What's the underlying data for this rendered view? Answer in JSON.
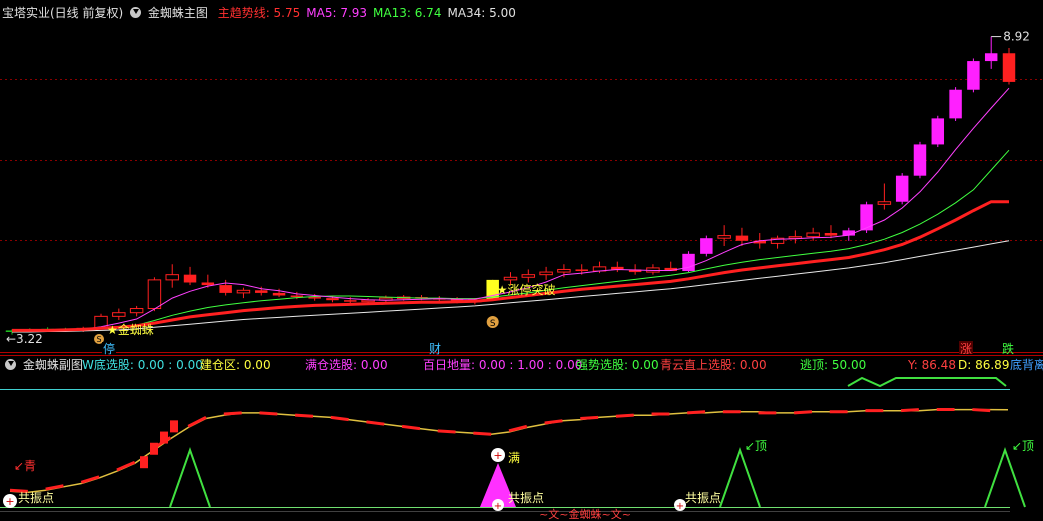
{
  "main_header": {
    "stock": "宝塔实业(日线 前复权)",
    "indicator": "金蜘蛛主图",
    "items": [
      {
        "label": "主趋势线:",
        "value": "5.75",
        "color": "#ff3030"
      },
      {
        "label": "MA5:",
        "value": "7.93",
        "color": "#ff40ff"
      },
      {
        "label": "MA13:",
        "value": "6.74",
        "color": "#40ff40"
      },
      {
        "label": "MA34:",
        "value": "5.00",
        "color": "#e0e0e0"
      }
    ]
  },
  "sub_header": {
    "indicator": "金蜘蛛副图",
    "items": [
      {
        "text": "W底选股: 0.00 : 0.00",
        "color": "#40e0e0"
      },
      {
        "text": "建仓区: 0.00",
        "color": "#ffff40"
      },
      {
        "text": "满仓选股: 0.00",
        "color": "#ff40ff"
      },
      {
        "text": "百日地量: 0.00 : 1.00 : 0.00",
        "color": "#ff40ff"
      },
      {
        "text": "强势选股: 0.00",
        "color": "#40ff40"
      },
      {
        "text": "青云直上选股: 0.00",
        "color": "#ff4040"
      },
      {
        "text": "逃顶: 50.00",
        "color": "#40ff40"
      },
      {
        "text": "Y: 86.48",
        "color": "#ff4040"
      },
      {
        "text": "D: 86.89",
        "color": "#ffff40"
      },
      {
        "text": "底背离",
        "color": "#40a0ff"
      }
    ]
  },
  "price_labels": {
    "high": "8.92",
    "low": "3.22"
  },
  "markers": {
    "limit_up": "停",
    "finance": "财",
    "rise": "涨",
    "fall": "跌",
    "spider": "金蜘蛛",
    "breakout": "涨停突破",
    "s_icon": "S"
  },
  "sub_labels": {
    "qing": "青",
    "bottom_left": "共振点",
    "full": "满",
    "mid": "共振点",
    "right": "共振点",
    "top1": "顶",
    "top2": "顶",
    "spider_bottom": "~文~金蜘蛛~文~"
  },
  "colors": {
    "bg": "#000000",
    "up": "#ff2020",
    "down": "#ff2020",
    "magenta_candle": "#ff20ff",
    "grid": "#800000",
    "trend": "#ff2020",
    "ma5": "#ff40ff",
    "ma13": "#40ff40",
    "ma34": "#e8e8e8"
  },
  "chart_data": [
    {
      "type": "candlestick",
      "title": "金蜘蛛主图",
      "ylim": [
        3.0,
        9.2
      ],
      "candles": [
        [
          3.25,
          3.3,
          3.2,
          3.28
        ],
        [
          3.28,
          3.32,
          3.24,
          3.3
        ],
        [
          3.3,
          3.34,
          3.26,
          3.31
        ],
        [
          3.31,
          3.33,
          3.27,
          3.29
        ],
        [
          3.29,
          3.35,
          3.25,
          3.32
        ],
        [
          3.32,
          3.6,
          3.3,
          3.55
        ],
        [
          3.55,
          3.7,
          3.48,
          3.62
        ],
        [
          3.62,
          3.75,
          3.55,
          3.7
        ],
        [
          3.7,
          4.3,
          3.65,
          4.25
        ],
        [
          4.25,
          4.55,
          4.1,
          4.35
        ],
        [
          4.35,
          4.5,
          4.15,
          4.2
        ],
        [
          4.2,
          4.35,
          4.1,
          4.15
        ],
        [
          4.15,
          4.25,
          3.95,
          4.0
        ],
        [
          4.0,
          4.1,
          3.9,
          4.05
        ],
        [
          4.05,
          4.12,
          3.95,
          4.0
        ],
        [
          4.0,
          4.08,
          3.92,
          3.95
        ],
        [
          3.95,
          4.02,
          3.88,
          3.92
        ],
        [
          3.92,
          3.98,
          3.85,
          3.9
        ],
        [
          3.9,
          3.95,
          3.82,
          3.86
        ],
        [
          3.86,
          3.92,
          3.8,
          3.84
        ],
        [
          3.84,
          3.9,
          3.8,
          3.86
        ],
        [
          3.86,
          3.95,
          3.82,
          3.9
        ],
        [
          3.9,
          3.96,
          3.85,
          3.92
        ],
        [
          3.92,
          3.96,
          3.86,
          3.9
        ],
        [
          3.9,
          3.94,
          3.84,
          3.88
        ],
        [
          3.88,
          3.92,
          3.8,
          3.83
        ],
        [
          3.83,
          3.9,
          3.78,
          3.86
        ],
        [
          3.86,
          4.25,
          3.86,
          4.25
        ],
        [
          4.25,
          4.4,
          4.15,
          4.3
        ],
        [
          4.3,
          4.45,
          4.2,
          4.35
        ],
        [
          4.35,
          4.5,
          4.25,
          4.4
        ],
        [
          4.4,
          4.55,
          4.3,
          4.45
        ],
        [
          4.45,
          4.55,
          4.35,
          4.42
        ],
        [
          4.42,
          4.6,
          4.38,
          4.5
        ],
        [
          4.5,
          4.6,
          4.4,
          4.45
        ],
        [
          4.45,
          4.55,
          4.35,
          4.4
        ],
        [
          4.4,
          4.55,
          4.35,
          4.48
        ],
        [
          4.48,
          4.6,
          4.42,
          4.42
        ],
        [
          4.42,
          4.8,
          4.4,
          4.75
        ],
        [
          4.75,
          5.1,
          4.7,
          5.05
        ],
        [
          5.05,
          5.3,
          4.9,
          5.1
        ],
        [
          5.1,
          5.25,
          4.9,
          5.0
        ],
        [
          5.0,
          5.15,
          4.85,
          4.95
        ],
        [
          4.95,
          5.1,
          4.85,
          5.05
        ],
        [
          5.05,
          5.2,
          4.95,
          5.08
        ],
        [
          5.08,
          5.25,
          5.0,
          5.15
        ],
        [
          5.15,
          5.3,
          5.05,
          5.1
        ],
        [
          5.1,
          5.25,
          5.0,
          5.2
        ],
        [
          5.2,
          5.75,
          5.15,
          5.7
        ],
        [
          5.7,
          6.1,
          5.6,
          5.75
        ],
        [
          5.75,
          6.3,
          5.7,
          6.25
        ],
        [
          6.25,
          6.9,
          6.2,
          6.85
        ],
        [
          6.85,
          7.4,
          6.8,
          7.35
        ],
        [
          7.35,
          7.95,
          7.3,
          7.9
        ],
        [
          7.9,
          8.5,
          7.85,
          8.45
        ],
        [
          8.45,
          8.92,
          8.3,
          8.6
        ],
        [
          8.6,
          8.7,
          8.0,
          8.05
        ]
      ],
      "trend": [
        3.28,
        3.28,
        3.28,
        3.29,
        3.3,
        3.32,
        3.34,
        3.37,
        3.42,
        3.48,
        3.54,
        3.58,
        3.62,
        3.66,
        3.69,
        3.72,
        3.74,
        3.76,
        3.77,
        3.78,
        3.79,
        3.8,
        3.81,
        3.82,
        3.82,
        3.83,
        3.84,
        3.87,
        3.91,
        3.95,
        3.99,
        4.03,
        4.07,
        4.1,
        4.13,
        4.16,
        4.19,
        4.22,
        4.27,
        4.33,
        4.39,
        4.44,
        4.48,
        4.52,
        4.56,
        4.6,
        4.64,
        4.68,
        4.75,
        4.83,
        4.93,
        5.07,
        5.23,
        5.4,
        5.58,
        5.75,
        5.75
      ],
      "ma5": [
        3.27,
        3.28,
        3.29,
        3.3,
        3.3,
        3.35,
        3.42,
        3.5,
        3.69,
        3.9,
        4.03,
        4.13,
        4.19,
        4.16,
        4.08,
        4.04,
        3.98,
        3.95,
        3.92,
        3.89,
        3.87,
        3.86,
        3.87,
        3.88,
        3.89,
        3.88,
        3.88,
        3.95,
        4.02,
        4.1,
        4.21,
        4.35,
        4.38,
        4.42,
        4.45,
        4.44,
        4.43,
        4.43,
        4.49,
        4.62,
        4.78,
        4.93,
        5.0,
        5.03,
        5.04,
        5.06,
        5.07,
        5.11,
        5.25,
        5.4,
        5.63,
        5.94,
        6.32,
        6.75,
        7.16,
        7.55,
        7.93
      ],
      "ma13": [
        3.26,
        3.27,
        3.28,
        3.29,
        3.29,
        3.31,
        3.34,
        3.38,
        3.47,
        3.57,
        3.65,
        3.72,
        3.77,
        3.81,
        3.85,
        3.88,
        3.91,
        3.93,
        3.94,
        3.94,
        3.93,
        3.92,
        3.91,
        3.9,
        3.9,
        3.89,
        3.89,
        3.92,
        3.96,
        4.0,
        4.05,
        4.1,
        4.14,
        4.18,
        4.22,
        4.26,
        4.3,
        4.34,
        4.39,
        4.46,
        4.53,
        4.59,
        4.64,
        4.68,
        4.72,
        4.76,
        4.8,
        4.85,
        4.93,
        5.03,
        5.16,
        5.32,
        5.51,
        5.73,
        5.98,
        6.36,
        6.74
      ],
      "ma34": [
        3.25,
        3.25,
        3.26,
        3.26,
        3.27,
        3.28,
        3.29,
        3.31,
        3.34,
        3.37,
        3.4,
        3.43,
        3.46,
        3.49,
        3.51,
        3.53,
        3.55,
        3.57,
        3.59,
        3.61,
        3.63,
        3.65,
        3.67,
        3.69,
        3.71,
        3.73,
        3.75,
        3.78,
        3.81,
        3.84,
        3.87,
        3.9,
        3.93,
        3.96,
        3.99,
        4.02,
        4.05,
        4.08,
        4.12,
        4.16,
        4.2,
        4.24,
        4.28,
        4.32,
        4.36,
        4.4,
        4.44,
        4.48,
        4.53,
        4.58,
        4.64,
        4.7,
        4.76,
        4.82,
        4.88,
        4.94,
        5.0
      ]
    },
    {
      "type": "line",
      "title": "金蜘蛛副图",
      "ylim": [
        0,
        100
      ],
      "series": [
        {
          "name": "Y",
          "color": "#ff2020",
          "values": [
            15,
            14,
            16,
            19,
            22,
            27,
            33,
            40,
            52,
            62,
            72,
            80,
            83,
            84,
            84,
            83,
            82,
            81,
            80,
            78,
            76,
            74,
            72,
            70,
            68,
            67,
            66,
            65,
            68,
            72,
            75,
            77,
            79,
            80,
            81,
            82,
            83,
            83,
            84,
            85,
            85,
            85,
            84,
            84,
            84,
            85,
            85,
            85,
            86,
            86,
            86,
            87,
            87,
            87,
            87,
            86,
            86.48
          ]
        },
        {
          "name": "D",
          "color": "#ffff40",
          "values": [
            14,
            13,
            15,
            18,
            21,
            26,
            32,
            39,
            50,
            61,
            71,
            79,
            82,
            84,
            84,
            83,
            82,
            81,
            80,
            78,
            76,
            74,
            72,
            70,
            68,
            67,
            66,
            65,
            67,
            71,
            74,
            77,
            78,
            80,
            81,
            82,
            82,
            83,
            84,
            84,
            85,
            85,
            85,
            84,
            84,
            85,
            85,
            85,
            86,
            86,
            86,
            86,
            87,
            87,
            87,
            87,
            86.89
          ]
        }
      ]
    }
  ]
}
